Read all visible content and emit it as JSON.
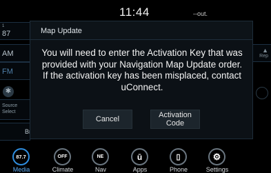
{
  "status_bar": {
    "time": "11:44",
    "outside_temp": "--out."
  },
  "background_panel": {
    "preset_number": "1",
    "preset_freq": "87",
    "am_label": "AM",
    "fm_label": "FM",
    "source_select_line1": "Source",
    "source_select_line2": "Select",
    "browse_label": "Br",
    "right_label": "Rep"
  },
  "modal": {
    "title": "Map Update",
    "message": "You will need to enter the Activation Key that was provided with your Navigation Map Update order.  If the activation key has been misplaced, contact uConnect.",
    "cancel_label": "Cancel",
    "activation_label_line1": "Activation",
    "activation_label_line2": "Code"
  },
  "bottom_nav": {
    "items": [
      {
        "label": "Media",
        "icon_text": "87.7",
        "icon": "radio-icon",
        "active": true
      },
      {
        "label": "Climate",
        "icon_text": "OFF",
        "icon": "climate-icon",
        "active": false
      },
      {
        "label": "Nav",
        "icon_text": "NE",
        "icon": "compass-icon",
        "active": false
      },
      {
        "label": "Apps",
        "icon_text": "ū",
        "icon": "apps-icon",
        "active": false
      },
      {
        "label": "Phone",
        "icon_text": "▯",
        "icon": "phone-icon",
        "active": false
      },
      {
        "label": "Settings",
        "icon_text": "⚙",
        "icon": "settings-icon",
        "active": false
      }
    ]
  },
  "colors": {
    "accent": "#2f8ee0",
    "modal_bg": "#0c1116"
  }
}
